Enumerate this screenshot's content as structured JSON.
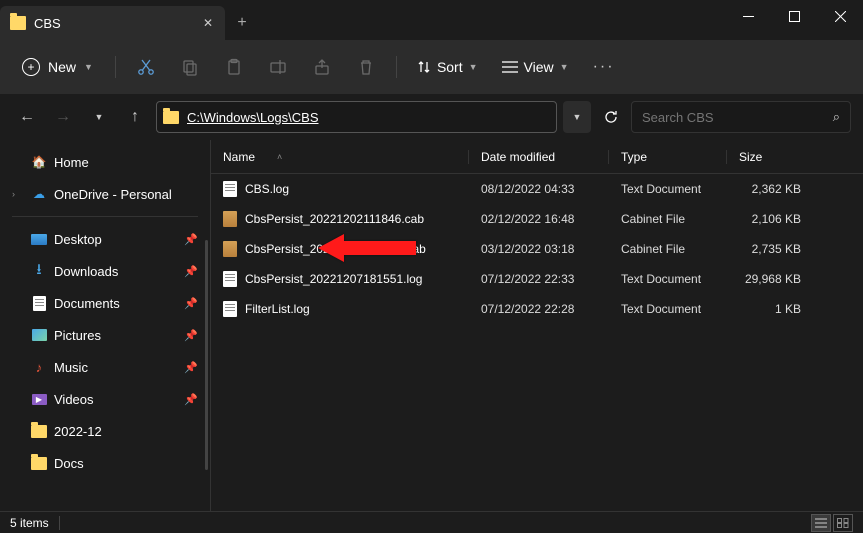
{
  "titlebar": {
    "tab_title": "CBS"
  },
  "toolbar": {
    "new_label": "New",
    "sort_label": "Sort",
    "view_label": "View"
  },
  "nav": {
    "path": "C:\\Windows\\Logs\\CBS",
    "search_placeholder": "Search CBS"
  },
  "columns": {
    "name": "Name",
    "date": "Date modified",
    "type": "Type",
    "size": "Size"
  },
  "sidebar": {
    "home": "Home",
    "onedrive": "OneDrive - Personal",
    "quick": [
      {
        "label": "Desktop"
      },
      {
        "label": "Downloads"
      },
      {
        "label": "Documents"
      },
      {
        "label": "Pictures"
      },
      {
        "label": "Music"
      },
      {
        "label": "Videos"
      },
      {
        "label": "2022-12"
      },
      {
        "label": "Docs"
      }
    ]
  },
  "files": [
    {
      "name": "CBS.log",
      "date": "08/12/2022 04:33",
      "type": "Text Document",
      "size": "2,362 KB",
      "icon": "doc"
    },
    {
      "name": "CbsPersist_20221202111846.cab",
      "date": "02/12/2022 16:48",
      "type": "Cabinet File",
      "size": "2,106 KB",
      "icon": "cab"
    },
    {
      "name": "CbsPersist_20221202220024.cab",
      "date": "03/12/2022 03:18",
      "type": "Cabinet File",
      "size": "2,735 KB",
      "icon": "cab"
    },
    {
      "name": "CbsPersist_20221207181551.log",
      "date": "07/12/2022 22:33",
      "type": "Text Document",
      "size": "29,968 KB",
      "icon": "doc"
    },
    {
      "name": "FilterList.log",
      "date": "07/12/2022 22:28",
      "type": "Text Document",
      "size": "1 KB",
      "icon": "doc"
    }
  ],
  "status": {
    "count": "5 items"
  }
}
